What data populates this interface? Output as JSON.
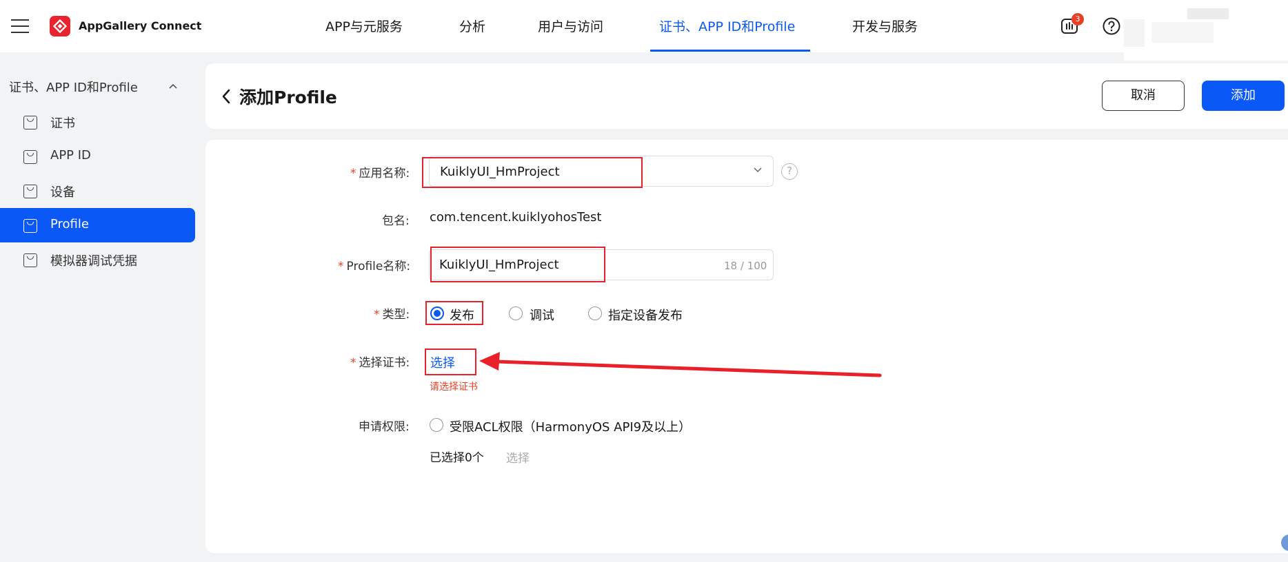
{
  "header": {
    "brand": "AppGallery Connect",
    "nav": [
      {
        "label": "APP与元服务"
      },
      {
        "label": "分析"
      },
      {
        "label": "用户与访问"
      },
      {
        "label": "证书、APP ID和Profile",
        "active": true
      },
      {
        "label": "开发与服务"
      }
    ],
    "notification_count": "3"
  },
  "sidebar": {
    "section_title": "证书、APP ID和Profile",
    "items": [
      {
        "label": "证书"
      },
      {
        "label": "APP ID"
      },
      {
        "label": "设备"
      },
      {
        "label": "Profile",
        "active": true
      },
      {
        "label": "模拟器调试凭据"
      }
    ]
  },
  "page": {
    "title": "添加Profile",
    "cancel_label": "取消",
    "add_label": "添加"
  },
  "form": {
    "required_mark": "*",
    "app_name": {
      "label": "应用名称:",
      "value": "KuiklyUI_HmProject",
      "help": "?"
    },
    "package": {
      "label": "包名:",
      "value": "com.tencent.kuiklyohosTest"
    },
    "profile_name": {
      "label": "Profile名称:",
      "value": "KuiklyUI_HmProject",
      "counter": "18 / 100"
    },
    "type": {
      "label": "类型:",
      "options": [
        {
          "label": "发布",
          "checked": true
        },
        {
          "label": "调试",
          "checked": false
        },
        {
          "label": "指定设备发布",
          "checked": false
        }
      ]
    },
    "certificate": {
      "label": "选择证书:",
      "link": "选择",
      "error": "请选择证书"
    },
    "permission": {
      "label": "申请权限:",
      "option": "受限ACL权限（HarmonyOS API9及以上）",
      "selected_count": "已选择0个",
      "select_link": "选择"
    }
  },
  "colors": {
    "accent": "#0a59f7",
    "error": "#e84026",
    "annotation": "#e8202a",
    "logo": "#e8252f"
  }
}
